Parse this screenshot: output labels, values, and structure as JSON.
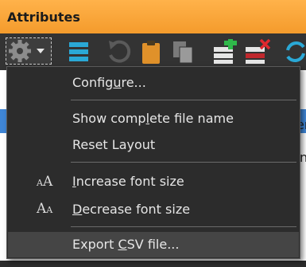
{
  "window": {
    "title": "Attributes"
  },
  "toolbar": {
    "buttons": [
      {
        "icon": "gear-dropdown-icon"
      },
      {
        "icon": "list-icon"
      },
      {
        "icon": "undo-icon"
      },
      {
        "icon": "clipboard-icon"
      },
      {
        "icon": "copy-icon"
      },
      {
        "icon": "add-row-icon"
      },
      {
        "icon": "delete-row-icon"
      },
      {
        "icon": "refresh-icon"
      }
    ]
  },
  "background_list": {
    "partial_text_right_1": "er",
    "partial_text_right_2": "n"
  },
  "menu": {
    "items": [
      {
        "id": "configure",
        "label_pre": "Config",
        "label_ul": "u",
        "label_post": "re..."
      },
      {
        "id": "show-complete",
        "label_pre": "Show comp",
        "label_ul": "l",
        "label_post": "ete file name"
      },
      {
        "id": "reset-layout",
        "label_pre": "Reset Layout",
        "label_ul": "",
        "label_post": ""
      },
      {
        "id": "increase-font",
        "label_pre": "",
        "label_ul": "I",
        "label_post": "ncrease font size"
      },
      {
        "id": "decrease-font",
        "label_pre": "",
        "label_ul": "D",
        "label_post": "ecrease font size"
      },
      {
        "id": "export-csv",
        "label_pre": "Export ",
        "label_ul": "C",
        "label_post": "SV file..."
      }
    ]
  },
  "colors": {
    "title_bar": "#f49b2c",
    "menu_bg": "#2c2c2c",
    "menu_hover": "#454545",
    "selection": "#3f86d6"
  }
}
